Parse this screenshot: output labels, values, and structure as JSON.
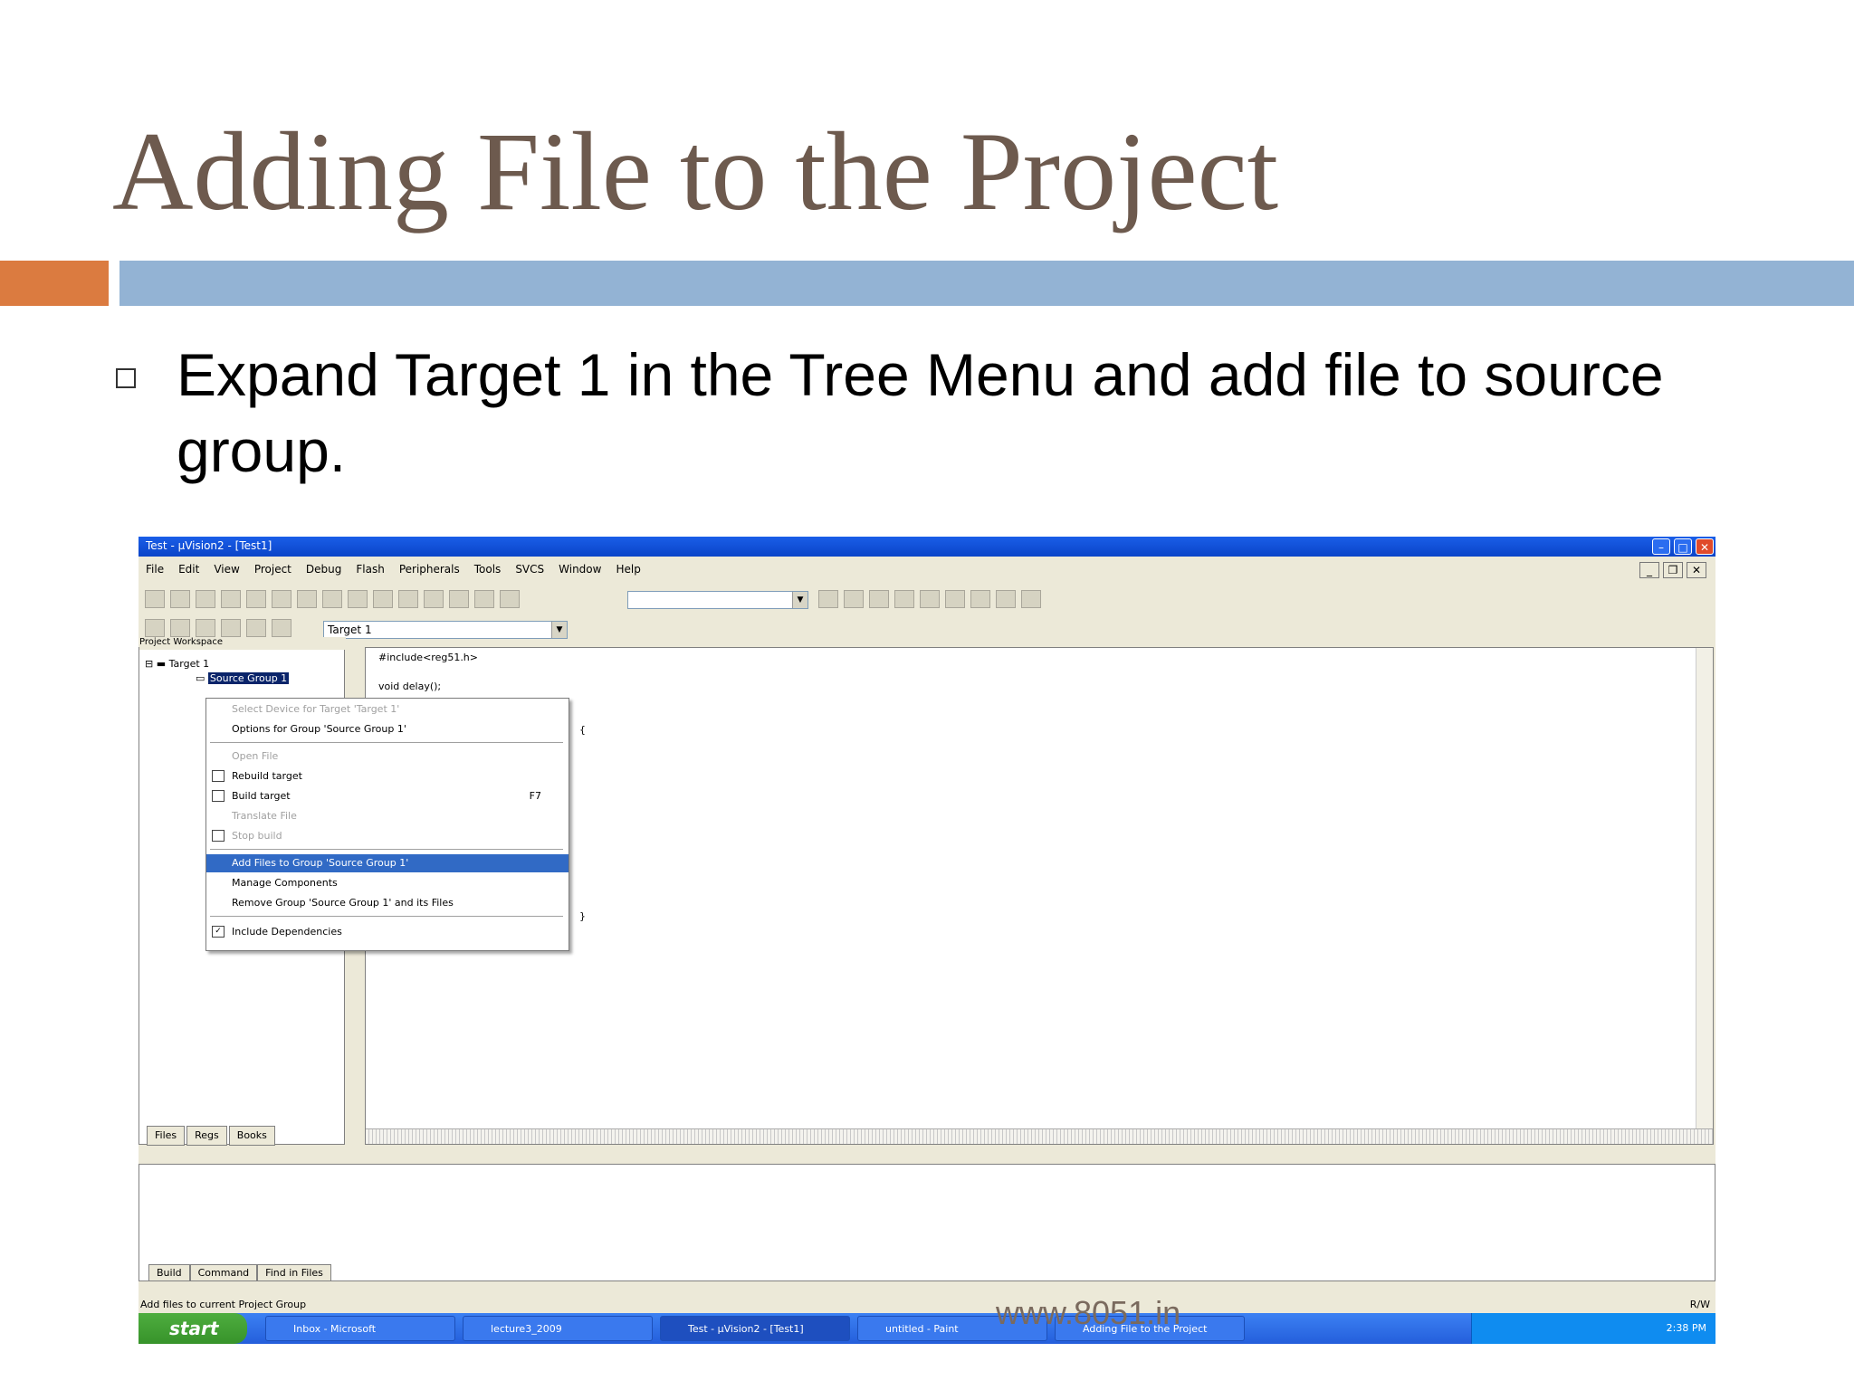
{
  "slide": {
    "title": "Adding File to the Project",
    "bullet": "Expand Target 1 in the Tree Menu and add file to source group.",
    "watermark": "www.8051.in"
  },
  "app": {
    "window_title": "Test - µVision2 - [Test1]",
    "menu": [
      "File",
      "Edit",
      "View",
      "Project",
      "Debug",
      "Flash",
      "Peripherals",
      "Tools",
      "SVCS",
      "Window",
      "Help"
    ],
    "target_combo": "Target 1",
    "workspace_title": "Project Workspace",
    "tree": {
      "root": "Target 1",
      "child": "Source Group 1"
    },
    "workspace_tabs": [
      "Files",
      "Regs",
      "Books"
    ],
    "editor_lines": [
      "#include<reg51.h>",
      "void delay();",
      "{",
      "}"
    ],
    "context_menu": [
      {
        "label": "Select Device for Target 'Target 1'",
        "disabled": true
      },
      {
        "label": "Options for Group 'Source Group 1'",
        "disabled": false
      },
      {
        "label": "Open File",
        "disabled": true
      },
      {
        "label": "Rebuild target",
        "disabled": false
      },
      {
        "label": "Build target",
        "disabled": false,
        "shortcut": "F7"
      },
      {
        "label": "Translate File",
        "disabled": true
      },
      {
        "label": "Stop build",
        "disabled": true
      },
      {
        "label": "Add Files to Group 'Source Group 1'",
        "disabled": false,
        "highlighted": true
      },
      {
        "label": "Manage Components",
        "disabled": false
      },
      {
        "label": "Remove Group 'Source Group 1' and its Files",
        "disabled": false
      },
      {
        "label": "Include Dependencies",
        "disabled": false,
        "checked": true
      }
    ],
    "output_tabs": [
      "Build",
      "Command",
      "Find in Files"
    ],
    "status_left": "Add files to current Project Group",
    "status_right": "R/W",
    "taskbar": {
      "start": "start",
      "tasks": [
        "Inbox - Microsoft",
        "lecture3_2009",
        "Test - µVision2 - [Test1]",
        "untitled - Paint",
        "Adding File to the Project"
      ],
      "clock": "2:38 PM"
    }
  }
}
